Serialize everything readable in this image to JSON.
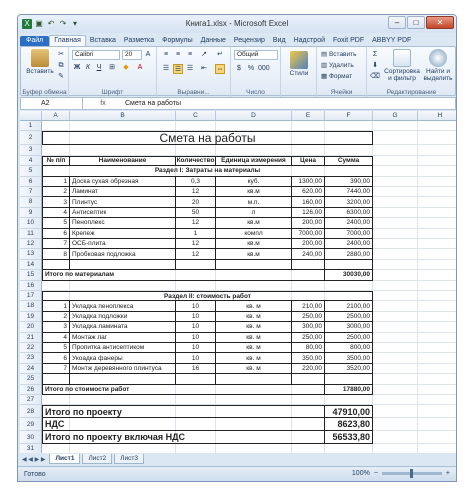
{
  "window": {
    "title": "Книга1.xlsx - Microsoft Excel",
    "qat_icons": [
      "excel-icon",
      "save-icon",
      "undo-icon",
      "redo-icon",
      "dropdown-icon"
    ]
  },
  "ribbon_tabs": [
    {
      "label": "Файл",
      "kind": "file"
    },
    {
      "label": "Главная",
      "kind": "active"
    },
    {
      "label": "Вставка",
      "kind": ""
    },
    {
      "label": "Разметка",
      "kind": ""
    },
    {
      "label": "Формулы",
      "kind": ""
    },
    {
      "label": "Данные",
      "kind": ""
    },
    {
      "label": "Рецензир",
      "kind": ""
    },
    {
      "label": "Вид",
      "kind": ""
    },
    {
      "label": "Надстрой",
      "kind": ""
    },
    {
      "label": "Foxit PDF",
      "kind": ""
    },
    {
      "label": "ABBYY PDF",
      "kind": ""
    }
  ],
  "ribbon": {
    "paste": "Вставить",
    "clipboard": "Буфер обмена",
    "font_name": "Calibri",
    "font_size": "20",
    "font_group": "Шрифт",
    "align_group": "Выравни...",
    "number_format": "Общий",
    "number_group": "Число",
    "styles": "Стили",
    "insert": "Вставить",
    "delete": "Удалить",
    "format": "Формат",
    "cells_group": "Ячейки",
    "sort": "Сортировка и фильтр",
    "find": "Найти и выделить",
    "editing_group": "Редактирование"
  },
  "formula_bar": {
    "name_box": "A2",
    "fx": "fx",
    "content": "Смета на работы"
  },
  "columns": [
    "A",
    "B",
    "C",
    "D",
    "E",
    "F",
    "G",
    "H"
  ],
  "sheet": {
    "title": "Смета на работы",
    "headers": [
      "№ п/п",
      "Наименование",
      "Количество",
      "Единица измерения",
      "Цена",
      "Сумма"
    ],
    "section1": "Раздел I: Затраты на материалы",
    "materials": [
      [
        "1",
        "Доска сухая обрезная",
        "0,3",
        "куб.",
        "1300,00",
        "390,00"
      ],
      [
        "2",
        "Ламинат",
        "12",
        "кв.м",
        "620,00",
        "7440,00"
      ],
      [
        "3",
        "Плинтус",
        "20",
        "м.п.",
        "160,00",
        "3200,00"
      ],
      [
        "4",
        "Антисептик",
        "50",
        "л",
        "126,00",
        "6300,00"
      ],
      [
        "5",
        "Пеноплекс",
        "12",
        "кв.м",
        "200,00",
        "2400,00"
      ],
      [
        "6",
        "Крепеж",
        "1",
        "компл",
        "7000,00",
        "7000,00"
      ],
      [
        "7",
        "ОСБ-плита",
        "12",
        "кв.м",
        "200,00",
        "2400,00"
      ],
      [
        "8",
        "Пробковая подложка",
        "12",
        "кв.м",
        "240,00",
        "2880,00"
      ]
    ],
    "materials_total_label": "Итого по материалам",
    "materials_total": "30030,00",
    "section2": "Раздел II: стоимость работ",
    "works": [
      [
        "1",
        "Укладка пеноплекса",
        "10",
        "кв. м",
        "210,00",
        "2100,00"
      ],
      [
        "2",
        "Укладка подложки",
        "10",
        "кв. м",
        "250,00",
        "2500,00"
      ],
      [
        "3",
        "Укладка  ламината",
        "10",
        "кв. м",
        "300,00",
        "3000,00"
      ],
      [
        "4",
        "Монтаж лаг",
        "10",
        "кв. м",
        "250,00",
        "2500,00"
      ],
      [
        "5",
        "Пропитка антисептиком",
        "10",
        "кв. м",
        "80,00",
        "800,00"
      ],
      [
        "6",
        "Укоадка фанеры",
        "10",
        "кв. м",
        "350,00",
        "3500,00"
      ],
      [
        "7",
        "Монтж деревянного плинтуса",
        "16",
        "кв. м",
        "220,00",
        "3520,00"
      ]
    ],
    "works_total_label": "Итого по стоимости работ",
    "works_total": "17880,00",
    "project_total_label": "Итого по проекту",
    "project_total": "47910,00",
    "vat_label": "НДС",
    "vat": "8623,80",
    "grand_total_label": "Итого по проекту включая НДС",
    "grand_total": "56533,80"
  },
  "row_numbers": [
    "1",
    "2",
    "3",
    "4",
    "5",
    "6",
    "7",
    "8",
    "9",
    "10",
    "11",
    "12",
    "13",
    "14",
    "15",
    "16",
    "17",
    "18",
    "19",
    "20",
    "21",
    "22",
    "23",
    "24",
    "25",
    "26",
    "27",
    "28",
    "29",
    "30",
    "31"
  ],
  "sheet_tabs": [
    "Лист1",
    "Лист2",
    "Лист3"
  ],
  "status": {
    "ready": "Готово",
    "zoom": "100%"
  }
}
